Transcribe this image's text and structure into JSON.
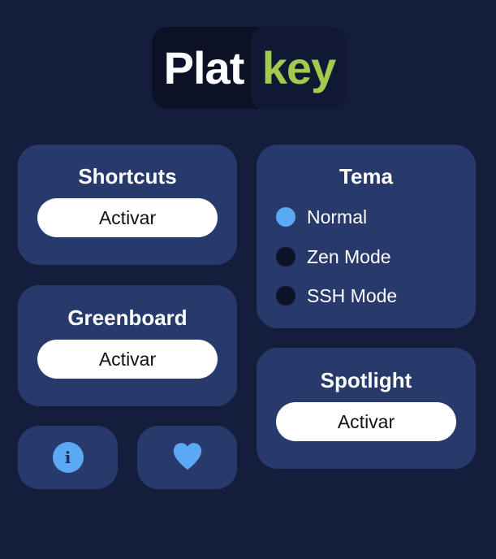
{
  "colors": {
    "background": "#141e3c",
    "card": "#28396b",
    "accent_blue": "#5ba8f5",
    "logo_green": "#a2ca4e"
  },
  "logo": {
    "part1": "Plat",
    "part2": "key"
  },
  "shortcuts": {
    "title": "Shortcuts",
    "button_label": "Activar"
  },
  "greenboard": {
    "title": "Greenboard",
    "button_label": "Activar"
  },
  "tema": {
    "title": "Tema",
    "options": [
      {
        "label": "Normal",
        "selected": true
      },
      {
        "label": "Zen Mode",
        "selected": false
      },
      {
        "label": "SSH Mode",
        "selected": false
      }
    ]
  },
  "spotlight": {
    "title": "Spotlight",
    "button_label": "Activar"
  },
  "icons": {
    "info": "info-icon",
    "info_glyph": "i",
    "heart": "heart-icon"
  }
}
